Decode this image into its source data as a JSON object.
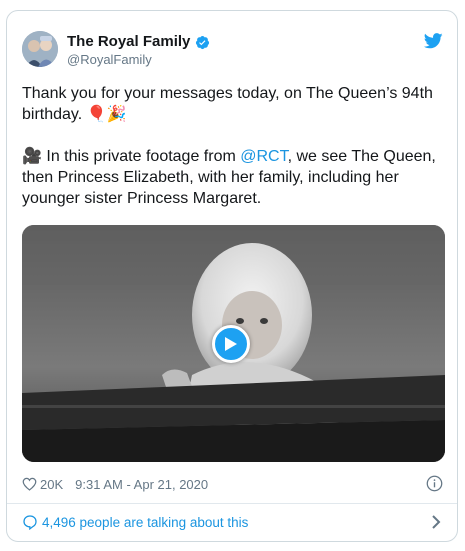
{
  "tweet": {
    "author_name": "The Royal Family",
    "handle": "@RoyalFamily",
    "line1": "Thank you for your messages today, on The Queen’s 94th birthday. 🎈🎉",
    "line2_prefix": "🎥 In this private footage from ",
    "line2_mention": "@RCT",
    "line2_suffix": ", we see The Queen, then Princess Elizabeth, with her family, including her younger sister Princess Margaret.",
    "likes": "20K",
    "timestamp": "9:31 AM - Apr 21, 2020",
    "talking": "4,496 people are talking about this"
  },
  "colors": {
    "accent": "#1da1f2",
    "link": "#1b95e0",
    "muted": "#657786",
    "border": "#cfd9de"
  },
  "icons": [
    "verified-badge-icon",
    "twitter-bird-icon",
    "play-icon",
    "heart-icon",
    "info-icon",
    "chat-bubble-icon",
    "chevron-right-icon"
  ]
}
